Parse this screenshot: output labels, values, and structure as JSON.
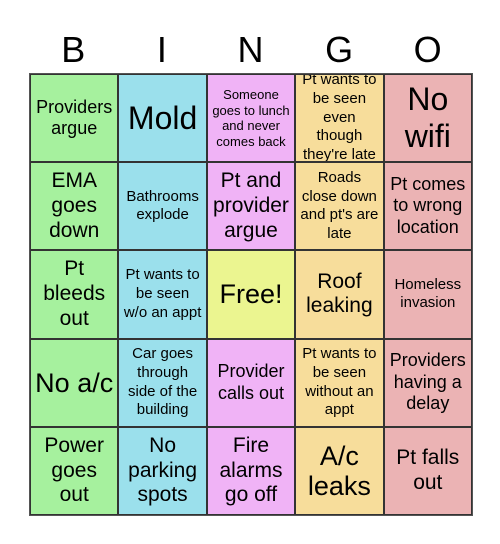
{
  "header": {
    "letters": [
      "B",
      "I",
      "N",
      "G",
      "O"
    ]
  },
  "colors": {
    "B": "#a6f19e",
    "I": "#9be0ec",
    "N": "#f0b3f6",
    "G": "#f7dd9b",
    "O": "#ebb3b4",
    "free": "#ebf590"
  },
  "rows": [
    [
      "Providers argue",
      "Mold",
      "Someone goes to lunch and never comes back",
      "Pt wants to be seen even though they're late",
      "No wifi"
    ],
    [
      "EMA goes down",
      "Bathrooms explode",
      "Pt and provider argue",
      "Roads close down and pt's are late",
      "Pt comes to wrong location"
    ],
    [
      "Pt bleeds out",
      "Pt wants to be seen w/o an appt",
      "Free!",
      "Roof leaking",
      "Homeless invasion"
    ],
    [
      "No a/c",
      "Car goes through side of the building",
      "Provider calls out",
      "Pt wants to be seen without an appt",
      "Providers having a delay"
    ],
    [
      "Power goes out",
      "No parking spots",
      "Fire alarms go off",
      "A/c leaks",
      "Pt falls out"
    ]
  ]
}
